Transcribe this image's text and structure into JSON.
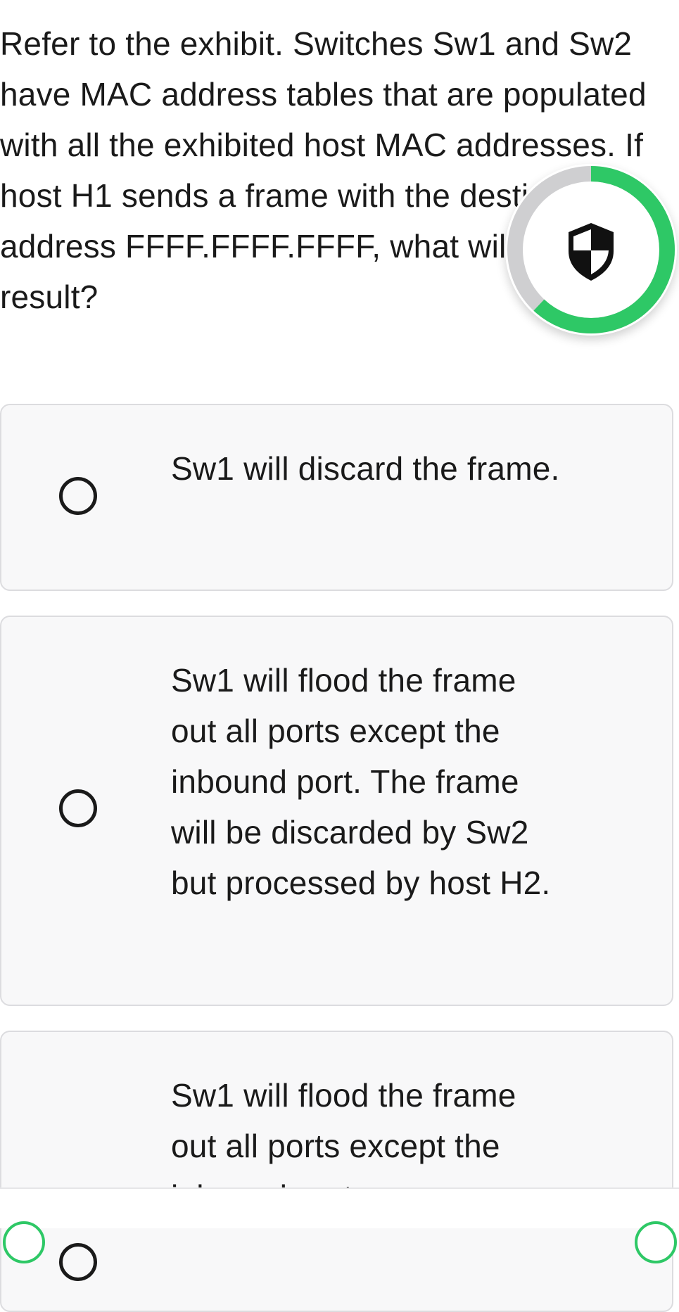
{
  "question": {
    "text": "Refer to the exhibit. Switches Sw1 and Sw2 have MAC address tables that are populated with all the exhibited host MAC addresses. If host H1 sends a frame with the destination address FFFF.FFFF.FFFF, what will be the result?"
  },
  "options": [
    {
      "label": "Sw1 will discard the frame.",
      "selected": false
    },
    {
      "label": "Sw1 will flood the frame out all ports except the inbound port. The frame will be discarded by Sw2 but processed by host H2.",
      "selected": false
    },
    {
      "label": "Sw1 will flood the frame out all ports except the inbound port.",
      "selected": false
    }
  ],
  "security_badge": {
    "icon": "shield-icon",
    "progress_fraction": 0.62,
    "ring_color": "#2ec866",
    "track_color": "#cfcfd1"
  },
  "colors": {
    "accent": "#2ec866",
    "card_background": "#f8f8f9",
    "card_border": "#dcdcdf"
  }
}
